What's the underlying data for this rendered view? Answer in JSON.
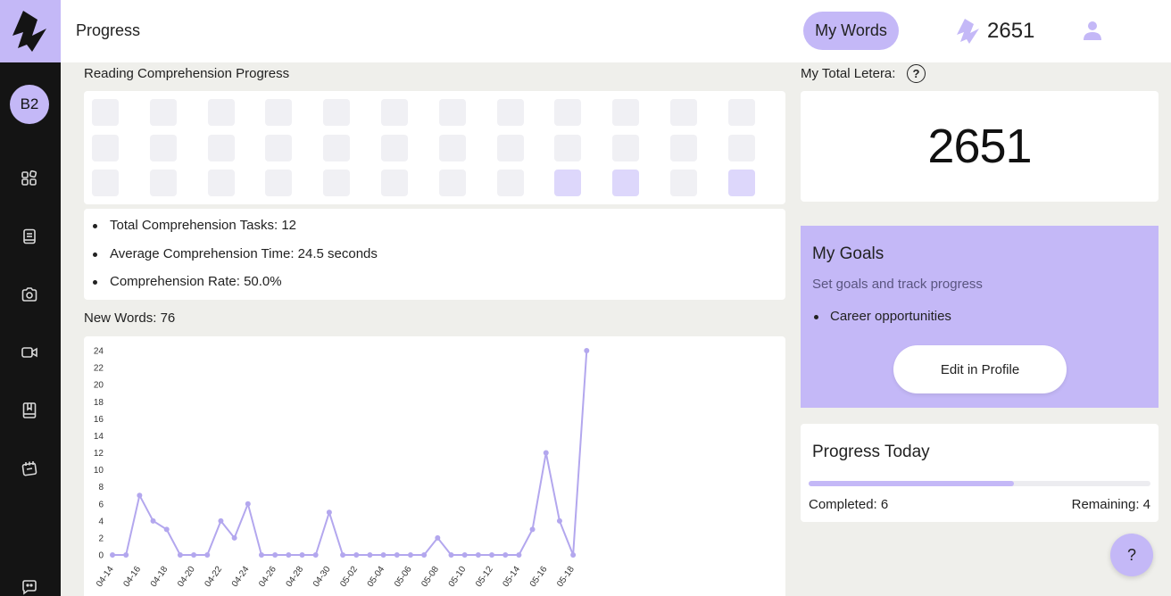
{
  "header": {
    "title": "Progress",
    "my_words_label": "My Words",
    "letera_count": "2651"
  },
  "sidebar": {
    "level": "B2",
    "items": [
      {
        "icon": "grid-icon"
      },
      {
        "icon": "book-icon"
      },
      {
        "icon": "camera-icon"
      },
      {
        "icon": "video-icon"
      },
      {
        "icon": "bookmark-book-icon"
      },
      {
        "icon": "notebook-icon"
      },
      {
        "icon": "chat-icon"
      }
    ]
  },
  "reading": {
    "label": "Reading Comprehension Progress",
    "grid": {
      "rows": 3,
      "cols": 12,
      "active_cells": [
        [
          2,
          8
        ],
        [
          2,
          9
        ],
        [
          2,
          11
        ]
      ]
    },
    "stats": [
      "Total Comprehension Tasks: 12",
      "Average Comprehension Time: 24.5 seconds",
      "Comprehension Rate: 50.0%"
    ]
  },
  "new_words": {
    "label": "New Words: 76"
  },
  "chart_data": {
    "type": "line",
    "x": [
      "04-14",
      "04-15",
      "04-16",
      "04-17",
      "04-18",
      "04-19",
      "04-20",
      "04-21",
      "04-22",
      "04-23",
      "04-24",
      "04-25",
      "04-26",
      "04-27",
      "04-28",
      "04-29",
      "04-30",
      "05-01",
      "05-02",
      "05-03",
      "05-04",
      "05-05",
      "05-06",
      "05-07",
      "05-08",
      "05-09",
      "05-10",
      "05-11",
      "05-12",
      "05-13",
      "05-14",
      "05-15",
      "05-16",
      "05-17",
      "05-18",
      "05-19"
    ],
    "x_tick_labels": [
      "04-14",
      "04-16",
      "04-18",
      "04-20",
      "04-22",
      "04-24",
      "04-26",
      "04-28",
      "04-30",
      "05-02",
      "05-04",
      "05-06",
      "05-08",
      "05-10",
      "05-12",
      "05-14",
      "05-16",
      "05-18"
    ],
    "series": [
      {
        "values": [
          0,
          0,
          7,
          4,
          3,
          0,
          0,
          0,
          4,
          2,
          6,
          0,
          0,
          0,
          0,
          0,
          5,
          0,
          0,
          0,
          0,
          0,
          0,
          0,
          2,
          0,
          0,
          0,
          0,
          0,
          0,
          3,
          12,
          4,
          0,
          24
        ]
      }
    ],
    "y_ticks": [
      0,
      2,
      4,
      6,
      8,
      10,
      12,
      14,
      16,
      18,
      20,
      22,
      24
    ],
    "ylim": [
      0,
      24
    ],
    "grid": false,
    "color": "#b3a7ee"
  },
  "total": {
    "label": "My Total Letera:",
    "help": "?",
    "value": "2651"
  },
  "goals": {
    "title": "My Goals",
    "subtitle": "Set goals and track progress",
    "items": [
      "Career opportunities"
    ],
    "edit_label": "Edit in Profile"
  },
  "today": {
    "title": "Progress Today",
    "completed_label": "Completed: 6",
    "remaining_label": "Remaining: 4",
    "progress_fraction": 0.6
  },
  "fab_help": "?",
  "colors": {
    "accent": "#c4b8f7",
    "sidebar_bg": "#141414",
    "page_bg": "#efefeb",
    "cell": "#f0f0f4",
    "cell_active": "#ddd7fb",
    "line": "#b3a7ee"
  }
}
